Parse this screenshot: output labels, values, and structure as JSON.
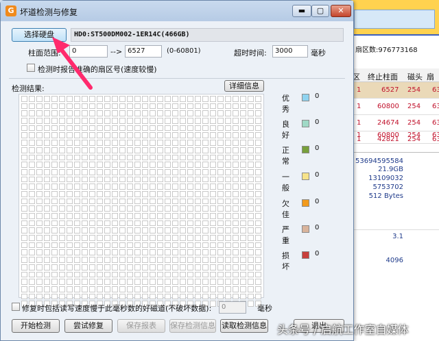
{
  "window": {
    "title": "坏道检测与修复",
    "app_icon_letter": "G",
    "minimize": "▬",
    "maximize": "▢",
    "close": "✕"
  },
  "disk": {
    "select_button": "选择硬盘",
    "info": "HD0:ST500DM002-1ER14C(466GB)"
  },
  "range": {
    "label": "柱面范围:",
    "start": "0",
    "arrow": "-->",
    "end": "6527",
    "hint": "(0-60801)"
  },
  "timeout": {
    "label": "超时时间:",
    "value": "3000",
    "unit": "毫秒"
  },
  "report_checkbox": {
    "label": "检测时报告准确的扇区号(速度较慢)",
    "checked": false
  },
  "results": {
    "label": "检测结果:",
    "detail_button": "详细信息"
  },
  "legend": [
    {
      "label": "优秀",
      "color": "#8fd3f0",
      "count": "0"
    },
    {
      "label": "良好",
      "color": "#9fd9c6",
      "count": "0"
    },
    {
      "label": "正常",
      "color": "#78a03c",
      "count": "0"
    },
    {
      "label": "一般",
      "color": "#f6e38a",
      "count": "0"
    },
    {
      "label": "欠佳",
      "color": "#f29a1c",
      "count": "0"
    },
    {
      "label": "严重",
      "color": "#d9b49c",
      "count": "0"
    },
    {
      "label": "损坏",
      "color": "#c8403c",
      "count": "0"
    }
  ],
  "repair_option": {
    "label": "修复时包括读写速度慢于此毫秒数的好磁道(不破坏数据):",
    "value": "0",
    "unit": "毫秒",
    "checked": false
  },
  "buttons": {
    "start": "开始检测",
    "try_repair": "尝试修复",
    "save_report": "保存报表",
    "save_info": "保存检测信息",
    "read_info": "读取检测信息",
    "exit": "退出"
  },
  "background_window": {
    "sector_count": "扇区数:976773168",
    "columns": [
      "区",
      "终止柱面",
      "磁头",
      "扇区"
    ],
    "rows": [
      {
        "c0": "1",
        "end": "6527",
        "heads": "254",
        "sec": "63"
      },
      {
        "c0": "1",
        "end": "60800",
        "heads": "254",
        "sec": "63"
      },
      {
        "c0": "1",
        "end": "24674",
        "heads": "254",
        "sec": "63"
      },
      {
        "c0": "1",
        "end": "42821",
        "heads": "254",
        "sec": "63"
      },
      {
        "c0": "1",
        "end": "60800",
        "heads": "254",
        "sec": "63"
      }
    ],
    "details": [
      "53694595584",
      "21.9GB",
      "13109032",
      "5753702",
      "512 Bytes"
    ],
    "version": "3.1",
    "cache": "4096"
  },
  "watermark": "头条号 / 启航工作室自媒体"
}
